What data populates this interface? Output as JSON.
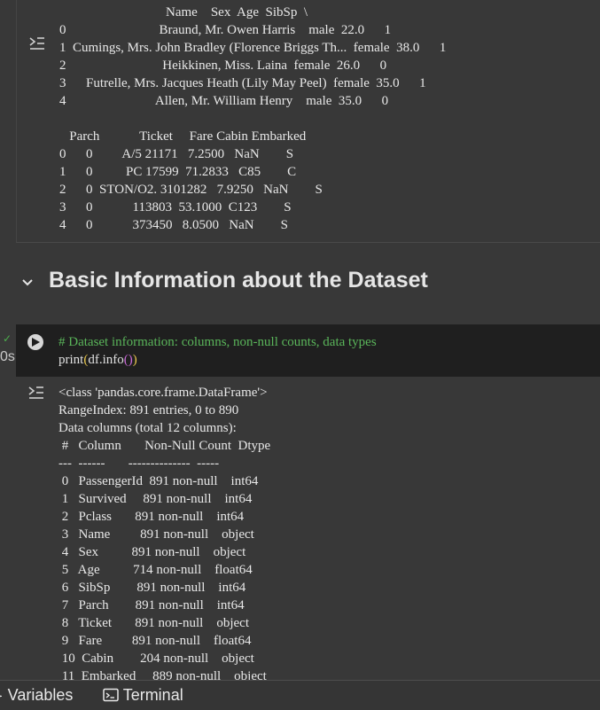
{
  "output_top": {
    "lines": [
      "                                Name    Sex  Age  SibSp  \\",
      "0                            Braund, Mr. Owen Harris    male  22.0      1",
      "1  Cumings, Mrs. John Bradley (Florence Briggs Th...  female  38.0      1",
      "2                             Heikkinen, Miss. Laina  female  26.0      0",
      "3      Futrelle, Mrs. Jacques Heath (Lily May Peel)  female  35.0      1",
      "4                           Allen, Mr. William Henry    male  35.0      0",
      "",
      "   Parch            Ticket     Fare Cabin Embarked",
      "0      0         A/5 21171   7.2500   NaN        S",
      "1      0          PC 17599  71.2833   C85        C",
      "2      0  STON/O2. 3101282   7.9250   NaN        S",
      "3      0            113803  53.1000  C123        S",
      "4      0            373450   8.0500   NaN        S"
    ]
  },
  "section": {
    "title": "Basic Information about the Dataset"
  },
  "cell": {
    "status_check": "✓",
    "exec_time": "0s",
    "comment": "# Dataset information: columns, non-null counts, data types",
    "code_prefix": "print",
    "code_mid": "df.info",
    "paren_inner": "()",
    "paren_open": "(",
    "paren_close": ")"
  },
  "output_info": {
    "lines": [
      "<class 'pandas.core.frame.DataFrame'>",
      "RangeIndex: 891 entries, 0 to 890",
      "Data columns (total 12 columns):",
      " #   Column       Non-Null Count  Dtype",
      "---  ------       --------------  -----",
      " 0   PassengerId  891 non-null    int64",
      " 1   Survived     891 non-null    int64",
      " 2   Pclass       891 non-null    int64",
      " 3   Name         891 non-null    object",
      " 4   Sex          891 non-null    object",
      " 5   Age          714 non-null    float64",
      " 6   SibSp        891 non-null    int64",
      " 7   Parch        891 non-null    int64",
      " 8   Ticket       891 non-null    object",
      " 9   Fare         891 non-null    float64",
      " 10  Cabin        204 non-null    object",
      " 11  Embarked     889 non-null    object"
    ]
  },
  "bottom_bar": {
    "variables_label": "Variables",
    "terminal_label": "Terminal"
  }
}
